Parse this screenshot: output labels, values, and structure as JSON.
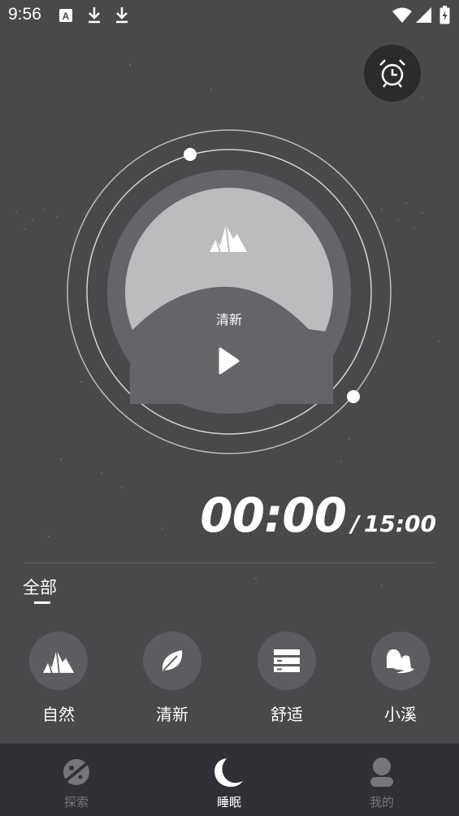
{
  "status_bar": {
    "time": "9:56",
    "icons": [
      "a-badge-icon",
      "download-icon",
      "download-icon",
      "wifi-icon",
      "signal-icon",
      "battery-charging-icon"
    ]
  },
  "player": {
    "sound_title": "清新",
    "icon": "mountain-icon",
    "play_icon": "play-icon"
  },
  "timer": {
    "elapsed": "00:00",
    "separator": "/",
    "total": "15:00"
  },
  "category": {
    "label": "全部"
  },
  "sounds": [
    {
      "name": "自然",
      "icon": "mountain-icon"
    },
    {
      "name": "清新",
      "icon": "leaf-icon"
    },
    {
      "name": "舒适",
      "icon": "lines-icon"
    },
    {
      "name": "小溪",
      "icon": "stream-icon"
    }
  ],
  "nav": {
    "items": [
      {
        "label": "探索",
        "icon": "planet-icon",
        "active": false
      },
      {
        "label": "睡眠",
        "icon": "moon-icon",
        "active": true
      },
      {
        "label": "我的",
        "icon": "user-icon",
        "active": false
      }
    ]
  },
  "colors": {
    "background": "#49484b",
    "nav_background": "#313036",
    "active": "#ffffff",
    "inactive": "#77767a"
  }
}
